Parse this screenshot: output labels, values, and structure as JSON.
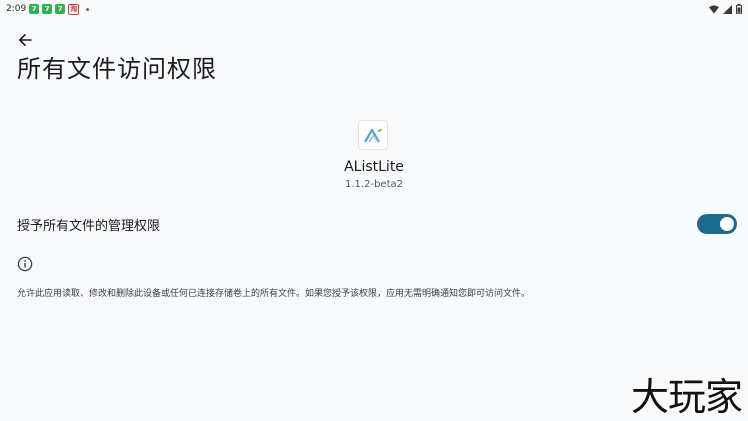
{
  "status_bar": {
    "time": "2:09",
    "notification_icons": [
      {
        "label": "7",
        "color": "#2fb34a"
      },
      {
        "label": "7",
        "color": "#2fb34a"
      },
      {
        "label": "7",
        "color": "#2fb34a"
      },
      {
        "label": "淘",
        "color": "#d23b3b"
      }
    ],
    "right_icons": [
      "wifi-icon",
      "signal-icon",
      "battery-icon"
    ]
  },
  "header": {
    "back_icon": "arrow-back-icon",
    "title": "所有文件访问权限"
  },
  "app": {
    "icon": "alist-logo-icon",
    "name": "AListLite",
    "version": "1.1.2-beta2"
  },
  "permission": {
    "label": "授予所有文件的管理权限",
    "enabled": true,
    "accent_color": "#1b6b8f"
  },
  "info": {
    "icon": "info-icon",
    "description": "允许此应用读取、修改和删除此设备或任何已连接存储卷上的所有文件。如果您授予该权限，应用无需明确通知您即可访问文件。"
  },
  "watermark": {
    "text": "大玩家"
  }
}
